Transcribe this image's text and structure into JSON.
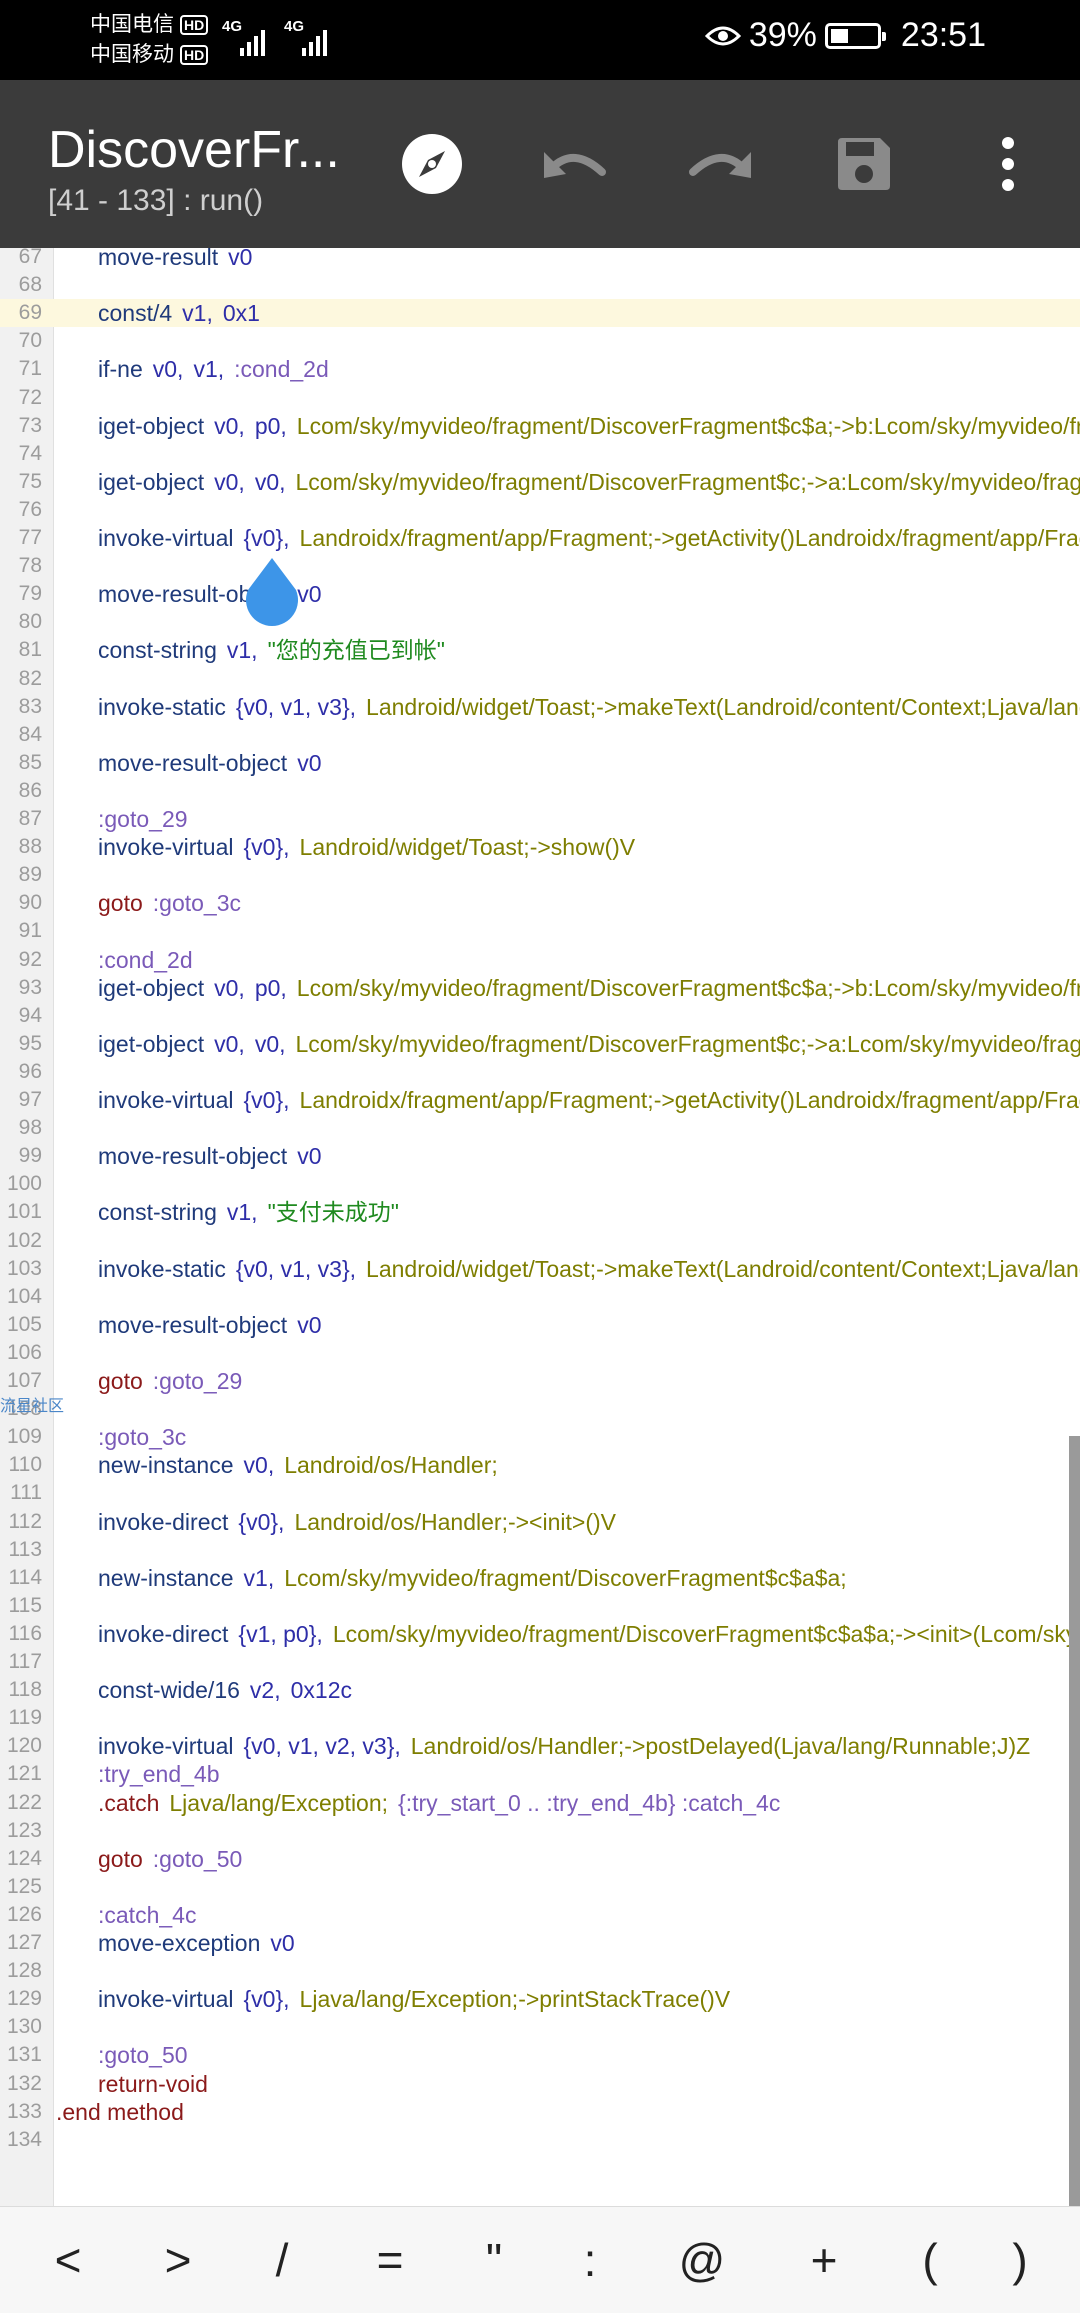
{
  "status_bar": {
    "carrier_1": "中国电信",
    "carrier_2": "中国移动",
    "hd_label": "HD",
    "network_1": "4G",
    "network_2": "4G",
    "battery_percent": "39%",
    "battery_level": 0.39,
    "time": "23:51"
  },
  "toolbar": {
    "title": "DiscoverFr...",
    "subtitle": "[41 - 133] : run()",
    "icons": [
      "compass-icon",
      "undo-icon",
      "redo-icon",
      "save-icon",
      "more-vert-icon"
    ]
  },
  "editor": {
    "highlighted_line": "69",
    "community_label": "流星社区",
    "lines": [
      {
        "n": "67",
        "t": [
          {
            "c": "kw",
            "v": "move-result"
          },
          {
            "c": "reg",
            "v": "v0"
          }
        ]
      },
      {
        "n": "68",
        "t": []
      },
      {
        "n": "69",
        "t": [
          {
            "c": "kw",
            "v": "const/4"
          },
          {
            "c": "reg",
            "v": "v1,"
          },
          {
            "c": "hx",
            "v": "0x1"
          }
        ]
      },
      {
        "n": "70",
        "t": []
      },
      {
        "n": "71",
        "t": [
          {
            "c": "kw",
            "v": "if-ne"
          },
          {
            "c": "reg",
            "v": "v0,"
          },
          {
            "c": "reg",
            "v": "v1,"
          },
          {
            "c": "lb",
            "v": ":cond_2d"
          }
        ]
      },
      {
        "n": "72",
        "t": []
      },
      {
        "n": "73",
        "t": [
          {
            "c": "kw",
            "v": "iget-object"
          },
          {
            "c": "reg",
            "v": "v0,"
          },
          {
            "c": "reg",
            "v": "p0,"
          },
          {
            "c": "ty",
            "v": "Lcom/sky/myvideo/fragment/DiscoverFragment$c$a;->b:Lcom/sky/myvideo/fragment/DiscoverFragment$c;"
          }
        ]
      },
      {
        "n": "74",
        "t": []
      },
      {
        "n": "75",
        "t": [
          {
            "c": "kw",
            "v": "iget-object"
          },
          {
            "c": "reg",
            "v": "v0,"
          },
          {
            "c": "reg",
            "v": "v0,"
          },
          {
            "c": "ty",
            "v": "Lcom/sky/myvideo/fragment/DiscoverFragment$c;->a:Lcom/sky/myvideo/fragment/DiscoverFragment;"
          }
        ]
      },
      {
        "n": "76",
        "t": []
      },
      {
        "n": "77",
        "t": [
          {
            "c": "kw",
            "v": "invoke-virtual"
          },
          {
            "c": "reg",
            "v": "{v0},"
          },
          {
            "c": "ty",
            "v": "Landroidx/fragment/app/Fragment;->getActivity()Landroidx/fragment/app/FragmentActivity;"
          }
        ]
      },
      {
        "n": "78",
        "t": []
      },
      {
        "n": "79",
        "t": [
          {
            "c": "kw",
            "v": "move-result-object"
          },
          {
            "c": "reg",
            "v": "v0"
          }
        ]
      },
      {
        "n": "80",
        "t": []
      },
      {
        "n": "81",
        "t": [
          {
            "c": "kw",
            "v": "const-string"
          },
          {
            "c": "reg",
            "v": "v1,"
          },
          {
            "c": "st",
            "v": "\"您的充值已到帐\""
          }
        ]
      },
      {
        "n": "82",
        "t": []
      },
      {
        "n": "83",
        "t": [
          {
            "c": "kw",
            "v": "invoke-static"
          },
          {
            "c": "reg",
            "v": "{v0, v1, v3},"
          },
          {
            "c": "ty",
            "v": "Landroid/widget/Toast;->makeText(Landroid/content/Context;Ljava/lang/CharSequence;I)Landroid/widget/Toast;"
          }
        ]
      },
      {
        "n": "84",
        "t": []
      },
      {
        "n": "85",
        "t": [
          {
            "c": "kw",
            "v": "move-result-object"
          },
          {
            "c": "reg",
            "v": "v0"
          }
        ]
      },
      {
        "n": "86",
        "t": []
      },
      {
        "n": "87",
        "t": [
          {
            "c": "lb",
            "v": ":goto_29"
          }
        ]
      },
      {
        "n": "88",
        "t": [
          {
            "c": "kw",
            "v": "invoke-virtual"
          },
          {
            "c": "reg",
            "v": "{v0},"
          },
          {
            "c": "ty",
            "v": "Landroid/widget/Toast;->show()V"
          }
        ]
      },
      {
        "n": "89",
        "t": []
      },
      {
        "n": "90",
        "t": [
          {
            "c": "kw2",
            "v": "goto"
          },
          {
            "c": "lb",
            "v": ":goto_3c"
          }
        ]
      },
      {
        "n": "91",
        "t": []
      },
      {
        "n": "92",
        "t": [
          {
            "c": "lb",
            "v": ":cond_2d"
          }
        ]
      },
      {
        "n": "93",
        "t": [
          {
            "c": "kw",
            "v": "iget-object"
          },
          {
            "c": "reg",
            "v": "v0,"
          },
          {
            "c": "reg",
            "v": "p0,"
          },
          {
            "c": "ty",
            "v": "Lcom/sky/myvideo/fragment/DiscoverFragment$c$a;->b:Lcom/sky/myvideo/fragment/DiscoverFragment$c;"
          }
        ]
      },
      {
        "n": "94",
        "t": []
      },
      {
        "n": "95",
        "t": [
          {
            "c": "kw",
            "v": "iget-object"
          },
          {
            "c": "reg",
            "v": "v0,"
          },
          {
            "c": "reg",
            "v": "v0,"
          },
          {
            "c": "ty",
            "v": "Lcom/sky/myvideo/fragment/DiscoverFragment$c;->a:Lcom/sky/myvideo/fragment/DiscoverFragment;"
          }
        ]
      },
      {
        "n": "96",
        "t": []
      },
      {
        "n": "97",
        "t": [
          {
            "c": "kw",
            "v": "invoke-virtual"
          },
          {
            "c": "reg",
            "v": "{v0},"
          },
          {
            "c": "ty",
            "v": "Landroidx/fragment/app/Fragment;->getActivity()Landroidx/fragment/app/FragmentActivity;"
          }
        ]
      },
      {
        "n": "98",
        "t": []
      },
      {
        "n": "99",
        "t": [
          {
            "c": "kw",
            "v": "move-result-object"
          },
          {
            "c": "reg",
            "v": "v0"
          }
        ]
      },
      {
        "n": "100",
        "t": []
      },
      {
        "n": "101",
        "t": [
          {
            "c": "kw",
            "v": "const-string"
          },
          {
            "c": "reg",
            "v": "v1,"
          },
          {
            "c": "st",
            "v": "\"支付未成功\""
          }
        ]
      },
      {
        "n": "102",
        "t": []
      },
      {
        "n": "103",
        "t": [
          {
            "c": "kw",
            "v": "invoke-static"
          },
          {
            "c": "reg",
            "v": "{v0, v1, v3},"
          },
          {
            "c": "ty",
            "v": "Landroid/widget/Toast;->makeText(Landroid/content/Context;Ljava/lang/CharSequence;I)Landroid/widget/Toast;"
          }
        ]
      },
      {
        "n": "104",
        "t": []
      },
      {
        "n": "105",
        "t": [
          {
            "c": "kw",
            "v": "move-result-object"
          },
          {
            "c": "reg",
            "v": "v0"
          }
        ]
      },
      {
        "n": "106",
        "t": []
      },
      {
        "n": "107",
        "t": [
          {
            "c": "kw2",
            "v": "goto"
          },
          {
            "c": "lb",
            "v": ":goto_29"
          }
        ]
      },
      {
        "n": "108",
        "t": []
      },
      {
        "n": "109",
        "t": [
          {
            "c": "lb",
            "v": ":goto_3c"
          }
        ]
      },
      {
        "n": "110",
        "t": [
          {
            "c": "kw",
            "v": "new-instance"
          },
          {
            "c": "reg",
            "v": "v0,"
          },
          {
            "c": "ty",
            "v": "Landroid/os/Handler;"
          }
        ]
      },
      {
        "n": "111",
        "t": []
      },
      {
        "n": "112",
        "t": [
          {
            "c": "kw",
            "v": "invoke-direct"
          },
          {
            "c": "reg",
            "v": "{v0},"
          },
          {
            "c": "ty",
            "v": "Landroid/os/Handler;-><init>()V"
          }
        ]
      },
      {
        "n": "113",
        "t": []
      },
      {
        "n": "114",
        "t": [
          {
            "c": "kw",
            "v": "new-instance"
          },
          {
            "c": "reg",
            "v": "v1,"
          },
          {
            "c": "ty",
            "v": "Lcom/sky/myvideo/fragment/DiscoverFragment$c$a$a;"
          }
        ]
      },
      {
        "n": "115",
        "t": []
      },
      {
        "n": "116",
        "t": [
          {
            "c": "kw",
            "v": "invoke-direct"
          },
          {
            "c": "reg",
            "v": "{v1, p0},"
          },
          {
            "c": "ty",
            "v": "Lcom/sky/myvideo/fragment/DiscoverFragment$c$a$a;-><init>(Lcom/sky/myvideo/fragment/DiscoverFragment$c$a;)V"
          }
        ]
      },
      {
        "n": "117",
        "t": []
      },
      {
        "n": "118",
        "t": [
          {
            "c": "kw",
            "v": "const-wide/16"
          },
          {
            "c": "reg",
            "v": "v2,"
          },
          {
            "c": "hx",
            "v": "0x12c"
          }
        ]
      },
      {
        "n": "119",
        "t": []
      },
      {
        "n": "120",
        "t": [
          {
            "c": "kw",
            "v": "invoke-virtual"
          },
          {
            "c": "reg",
            "v": "{v0, v1, v2, v3},"
          },
          {
            "c": "ty",
            "v": "Landroid/os/Handler;->postDelayed(Ljava/lang/Runnable;J)Z"
          }
        ]
      },
      {
        "n": "121",
        "t": [
          {
            "c": "lb",
            "v": ":try_end_4b"
          }
        ]
      },
      {
        "n": "122",
        "t": [
          {
            "c": "kw2",
            "v": ".catch"
          },
          {
            "c": "ty",
            "v": "Ljava/lang/Exception;"
          },
          {
            "c": "lb",
            "v": "{:try_start_0 .. :try_end_4b} :catch_4c"
          }
        ]
      },
      {
        "n": "123",
        "t": []
      },
      {
        "n": "124",
        "t": [
          {
            "c": "kw2",
            "v": "goto"
          },
          {
            "c": "lb",
            "v": ":goto_50"
          }
        ]
      },
      {
        "n": "125",
        "t": []
      },
      {
        "n": "126",
        "t": [
          {
            "c": "lb",
            "v": ":catch_4c"
          }
        ]
      },
      {
        "n": "127",
        "t": [
          {
            "c": "kw",
            "v": "move-exception"
          },
          {
            "c": "reg",
            "v": "v0"
          }
        ]
      },
      {
        "n": "128",
        "t": []
      },
      {
        "n": "129",
        "t": [
          {
            "c": "kw",
            "v": "invoke-virtual"
          },
          {
            "c": "reg",
            "v": "{v0},"
          },
          {
            "c": "ty",
            "v": "Ljava/lang/Exception;->printStackTrace()V"
          }
        ]
      },
      {
        "n": "130",
        "t": []
      },
      {
        "n": "131",
        "t": [
          {
            "c": "lb",
            "v": ":goto_50"
          }
        ]
      },
      {
        "n": "132",
        "t": [
          {
            "c": "kw2",
            "v": "return-void"
          }
        ]
      },
      {
        "n": "133",
        "t": [
          {
            "c": "kw2",
            "v": ".end method"
          }
        ],
        "outdent": true
      },
      {
        "n": "134",
        "t": []
      }
    ]
  },
  "symbols": [
    "<",
    ">",
    "/",
    "=",
    "\"",
    ":",
    "@",
    "+",
    "(",
    ")"
  ]
}
